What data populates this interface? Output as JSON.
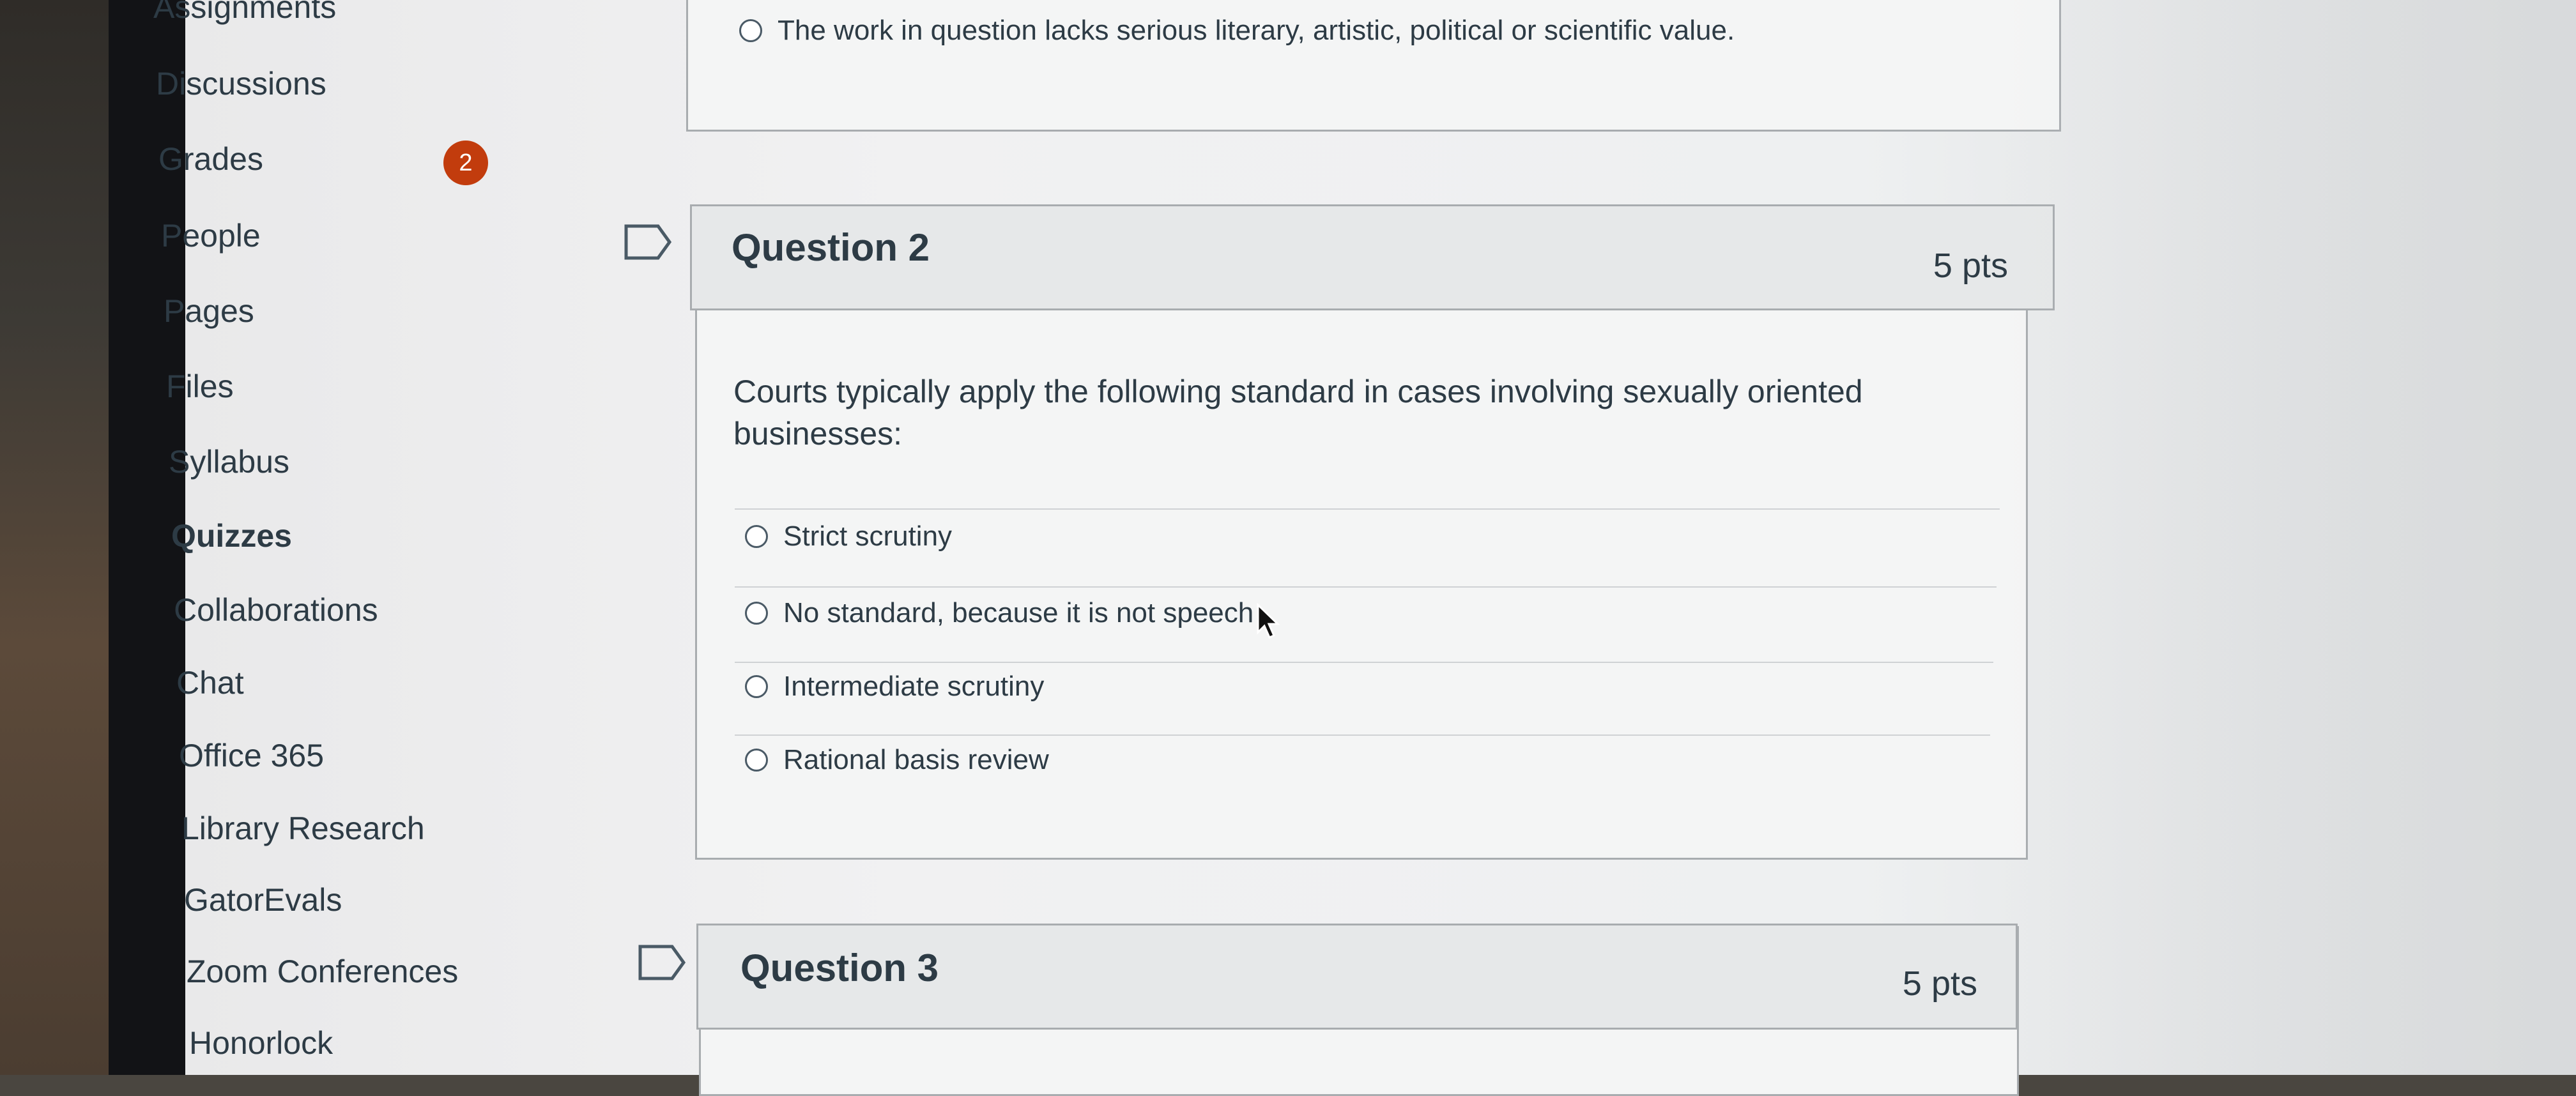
{
  "nav": {
    "items": [
      {
        "label": "Assignments"
      },
      {
        "label": "Discussions"
      },
      {
        "label": "Grades",
        "badge": "2"
      },
      {
        "label": "People"
      },
      {
        "label": "Pages"
      },
      {
        "label": "Files"
      },
      {
        "label": "Syllabus"
      },
      {
        "label": "Quizzes",
        "active": true
      },
      {
        "label": "Collaborations"
      },
      {
        "label": "Chat"
      },
      {
        "label": "Office 365"
      },
      {
        "label": "Library Research"
      },
      {
        "label": "GatorEvals"
      },
      {
        "label": "Zoom Conferences"
      },
      {
        "label": "Honorlock"
      }
    ]
  },
  "prev_question": {
    "answer": "The work in question lacks serious literary, artistic, political or scientific value."
  },
  "question2": {
    "title": "Question 2",
    "points": "5 pts",
    "text": "Courts typically apply the following standard in cases involving sexually oriented businesses:",
    "answers": [
      "Strict scrutiny",
      "No standard, because it is not speech",
      "Intermediate scrutiny",
      "Rational basis review"
    ]
  },
  "question3": {
    "title": "Question 3",
    "points": "5 pts"
  },
  "colors": {
    "badge": "#c23c0d",
    "text": "#2d3b45",
    "panel_border": "#a8acaf"
  },
  "icons": [
    "flag-icon",
    "radio-icon",
    "mouse-cursor-icon"
  ]
}
